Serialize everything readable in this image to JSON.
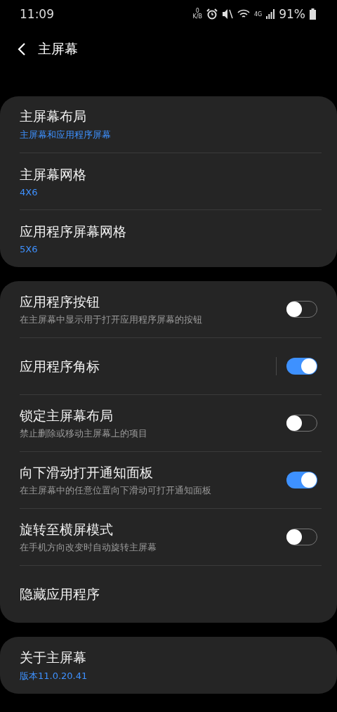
{
  "status_bar": {
    "time": "11:09",
    "net_speed_value": "0",
    "net_speed_unit": "K/B",
    "network": "4G",
    "battery": "91%"
  },
  "header": {
    "title": "主屏幕"
  },
  "groups": [
    {
      "items": [
        {
          "kind": "link",
          "title": "主屏幕布局",
          "value": "主屏幕和应用程序屏幕"
        },
        {
          "kind": "link",
          "title": "主屏幕网格",
          "value": "4X6"
        },
        {
          "kind": "link",
          "title": "应用程序屏幕网格",
          "value": "5X6"
        }
      ]
    },
    {
      "items": [
        {
          "kind": "switch",
          "title": "应用程序按钮",
          "description": "在主屏幕中显示用于打开应用程序屏幕的按钮",
          "on": false
        },
        {
          "kind": "split_switch",
          "title": "应用程序角标",
          "on": true
        },
        {
          "kind": "switch",
          "title": "锁定主屏幕布局",
          "description": "禁止删除或移动主屏幕上的项目",
          "on": false
        },
        {
          "kind": "switch",
          "title": "向下滑动打开通知面板",
          "description": "在主屏幕中的任意位置向下滑动可打开通知面板",
          "on": true
        },
        {
          "kind": "switch",
          "title": "旋转至横屏模式",
          "description": "在手机方向改变时自动旋转主屏幕",
          "on": false
        },
        {
          "kind": "link",
          "title": "隐藏应用程序"
        }
      ]
    },
    {
      "items": [
        {
          "kind": "link",
          "title": "关于主屏幕",
          "value": "版本11.0.20.41"
        }
      ]
    }
  ]
}
